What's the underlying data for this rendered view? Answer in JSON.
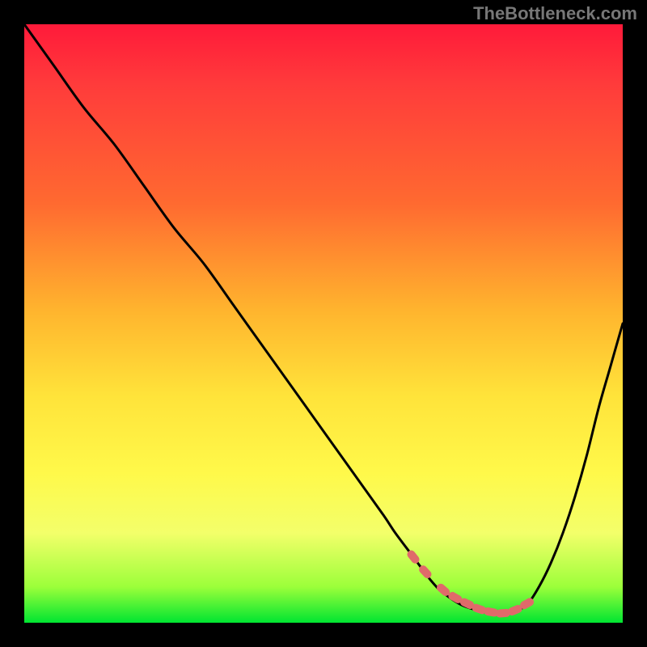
{
  "watermark": "TheBottleneck.com",
  "colors": {
    "curve": "#000000",
    "marker_fill": "#e06a6a",
    "marker_stroke": "#9c3a3a",
    "gradient_top": "#ff1a3a",
    "gradient_bottom": "#00e531"
  },
  "chart_data": {
    "type": "line",
    "title": "",
    "xlabel": "",
    "ylabel": "",
    "xlim": [
      0,
      100
    ],
    "ylim": [
      0,
      100
    ],
    "series": [
      {
        "name": "bottleneck-curve",
        "x": [
          0,
          5,
          10,
          15,
          20,
          25,
          30,
          35,
          40,
          45,
          50,
          55,
          60,
          62,
          65,
          68,
          70,
          73,
          76,
          78,
          80,
          82,
          84,
          86,
          88,
          90,
          92,
          94,
          96,
          98,
          100
        ],
        "y": [
          100,
          93,
          86,
          80,
          73,
          66,
          60,
          53,
          46,
          39,
          32,
          25,
          18,
          15,
          11,
          7,
          5,
          3,
          2,
          1.5,
          1.5,
          2,
          3,
          6,
          10,
          15,
          21,
          28,
          36,
          43,
          50
        ],
        "comment": "x is normalized horizontal position (0 left - 100 right). y is normalized vertical position (0 bottom - 100 top). Curve falls steeply from upper-left, reaches a broad minimum around x=76-82 near y≈1.5, then rises toward the right edge ending near mid-height."
      }
    ],
    "markers": {
      "name": "highlight-dots",
      "color": "#e06a6a",
      "style": "rounded-dash",
      "x": [
        65,
        67,
        70,
        72,
        74,
        76,
        78,
        80,
        82,
        84
      ],
      "y": [
        11,
        8.5,
        5.5,
        4.2,
        3.2,
        2.3,
        1.8,
        1.6,
        2.1,
        3.2
      ]
    }
  }
}
